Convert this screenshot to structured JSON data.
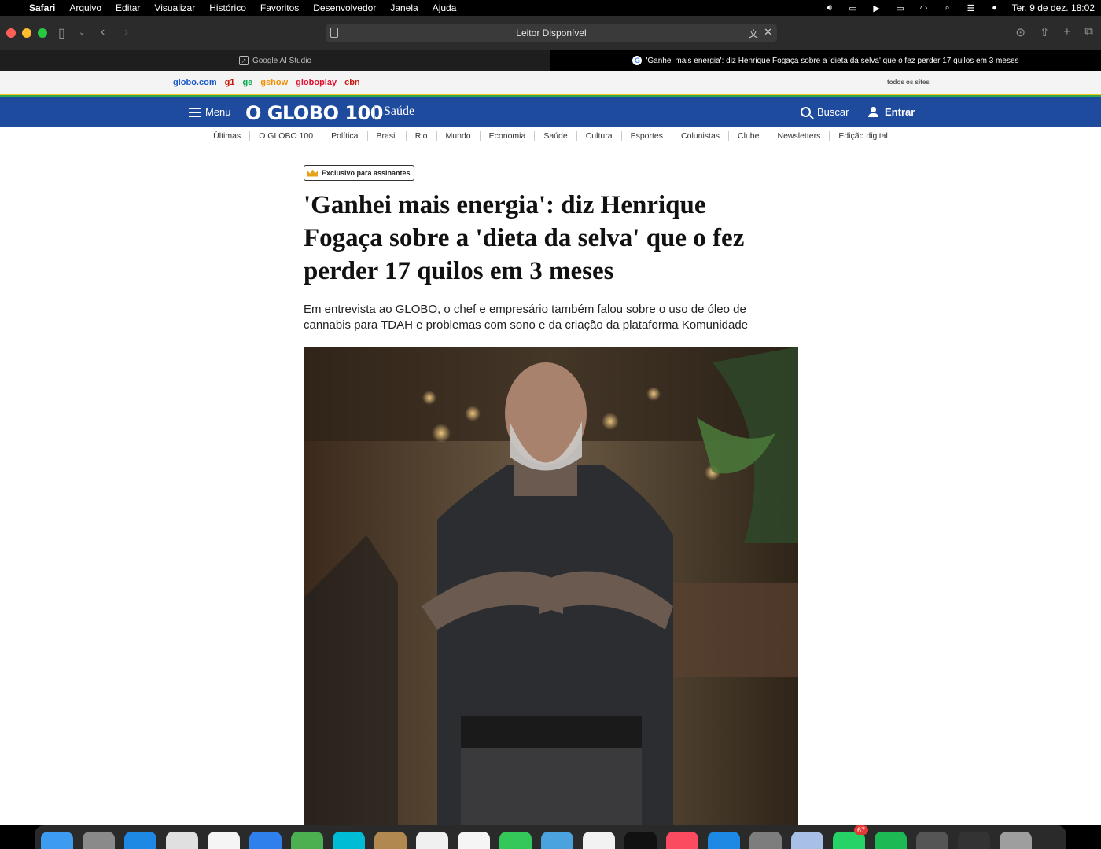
{
  "menubar": {
    "app": "Safari",
    "items": [
      "Arquivo",
      "Editar",
      "Visualizar",
      "Histórico",
      "Favoritos",
      "Desenvolvedor",
      "Janela",
      "Ajuda"
    ],
    "datetime": "Ter. 9 de dez.  18:02"
  },
  "toolbar": {
    "address_text": "Leitor Disponível"
  },
  "tabs": [
    {
      "label": "Google AI Studio"
    },
    {
      "label": "'Ganhei mais energia': diz Henrique Fogaça sobre a 'dieta da selva' que o fez perder 17 quilos em 3 meses"
    }
  ],
  "globobar": {
    "sites": [
      {
        "label": "globo.com",
        "color": "#1a5ac8"
      },
      {
        "label": "g1",
        "color": "#c4170c"
      },
      {
        "label": "ge",
        "color": "#06aa48"
      },
      {
        "label": "gshow",
        "color": "#f28c00"
      },
      {
        "label": "globoplay",
        "color": "#e0102e"
      },
      {
        "label": "cbn",
        "color": "#c4170c"
      }
    ],
    "all_sites": "todos os sites"
  },
  "header": {
    "menu_label": "Menu",
    "logo": "O GLOBO 100",
    "section": "Saúde",
    "search_label": "Buscar",
    "login_label": "Entrar"
  },
  "subnav": [
    "Últimas",
    "O GLOBO 100",
    "Política",
    "Brasil",
    "Rio",
    "Mundo",
    "Economia",
    "Saúde",
    "Cultura",
    "Esportes",
    "Colunistas",
    "Clube",
    "Newsletters",
    "Edição digital"
  ],
  "article": {
    "badge": "Exclusivo para assinantes",
    "headline": "'Ganhei mais energia': diz Henrique Fogaça sobre a 'dieta da selva' que o fez perder 17 quilos em 3 meses",
    "subtitle": "Em entrevista ao GLOBO, o chef e empresário também falou sobre o uso de óleo de cannabis para TDAH e problemas com sono e da criação da plataforma Komunidade"
  },
  "dock": {
    "whatsapp_badge": "67"
  },
  "colors": {
    "header_blue": "#1f4b9e",
    "badge_crown": "#e6a31a"
  }
}
